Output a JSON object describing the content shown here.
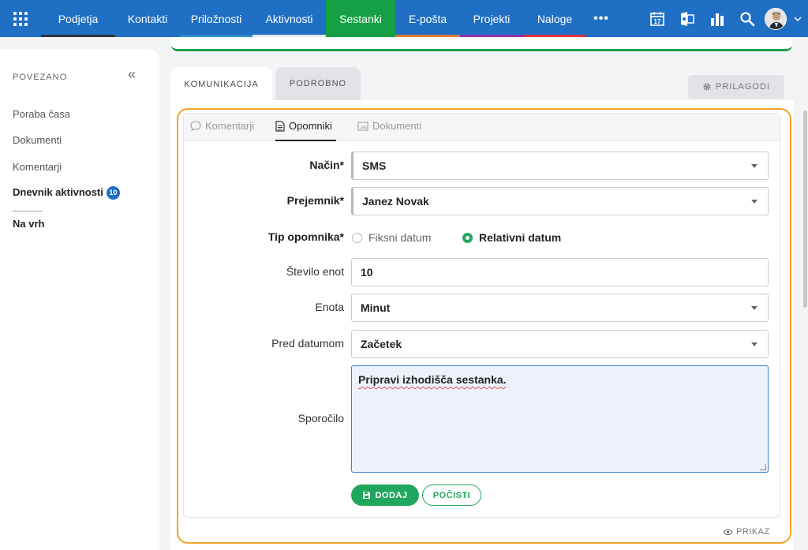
{
  "nav": {
    "tabs": [
      {
        "label": "Podjetja",
        "bar": "#30343c"
      },
      {
        "label": "Kontakti",
        "bar": "#1f6fc5"
      },
      {
        "label": "Priložnosti",
        "bar": "#2f8dd8"
      },
      {
        "label": "Aktivnosti",
        "bar": "#e5e7ea"
      },
      {
        "label": "Sestanki",
        "bar": "#15a045"
      },
      {
        "label": "E-pošta",
        "bar": "#e07a3b"
      },
      {
        "label": "Projekti",
        "bar": "#8d2fb5"
      },
      {
        "label": "Naloge",
        "bar": "#d8323a"
      }
    ],
    "more": "•••",
    "calendar_day": "17",
    "icons": [
      "apps-grid-icon",
      "calendar-icon",
      "exchange-icon",
      "reports-icon",
      "search-icon",
      "avatar",
      "chevron-down-icon"
    ]
  },
  "sidebar": {
    "title": "POVEZANO",
    "items": [
      "Poraba časa",
      "Dokumenti",
      "Komentarji",
      "Dnevnik aktivnosti"
    ],
    "badge": "10",
    "top_link": "Na vrh"
  },
  "tabs": {
    "komunikacija": "KOMUNIKACIJA",
    "podrobno": "PODROBNO",
    "prilagodi": "PRILAGODI"
  },
  "subtabs": [
    "Komentarji",
    "Opomniki",
    "Dokumenti"
  ],
  "form": {
    "nacin": {
      "label": "Način*",
      "value": "SMS"
    },
    "prejemnik": {
      "label": "Prejemnik*",
      "value": "Janez Novak"
    },
    "tip": {
      "label": "Tip opomnika*",
      "options": [
        "Fiksni datum",
        "Relativni datum"
      ],
      "selected": "Relativni datum"
    },
    "stevilo": {
      "label": "Število enot",
      "value": "10"
    },
    "enota": {
      "label": "Enota",
      "value": "Minut"
    },
    "pred": {
      "label": "Pred datumom",
      "value": "Začetek"
    },
    "sporocilo": {
      "label": "Sporočilo",
      "value": "Pripravi izhodišča sestanka."
    }
  },
  "buttons": {
    "dodaj": "DODAJ",
    "pocisti": "POČISTI",
    "prikaz": "PRIKAZ"
  },
  "colors": {
    "nav": "#1f6fc5",
    "active_tab": "#15a045",
    "accent_green": "#21a75d",
    "highlight": "#f3a325"
  }
}
